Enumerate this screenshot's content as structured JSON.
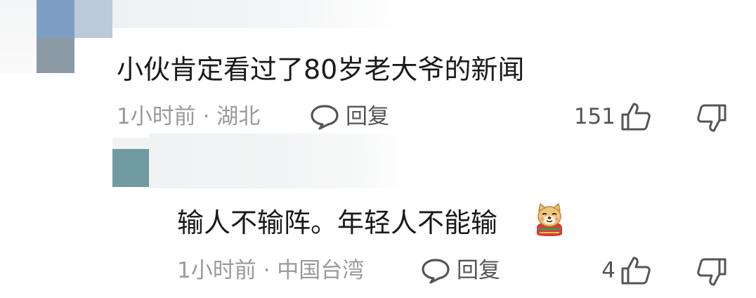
{
  "comments": [
    {
      "text": "小伙肯定看过了80岁老大爷的新闻",
      "time_location": "1小时前 · 湖北",
      "reply_label": "回复",
      "like_count": "151",
      "icons": {
        "reply": "chat-bubble-icon",
        "like": "thumbs-up-icon",
        "dislike": "thumbs-down-icon"
      }
    },
    {
      "text": "输人不输阵。年轻人不能输",
      "emoji": "doge-emoji-icon",
      "time_location": "1小时前 · 中国台湾",
      "reply_label": "回复",
      "like_count": "4",
      "icons": {
        "reply": "chat-bubble-icon",
        "like": "thumbs-up-icon",
        "dislike": "thumbs-down-icon"
      }
    }
  ],
  "colors": {
    "text": "#1a1a1a",
    "meta": "#9a9a9a",
    "action": "#555555"
  }
}
